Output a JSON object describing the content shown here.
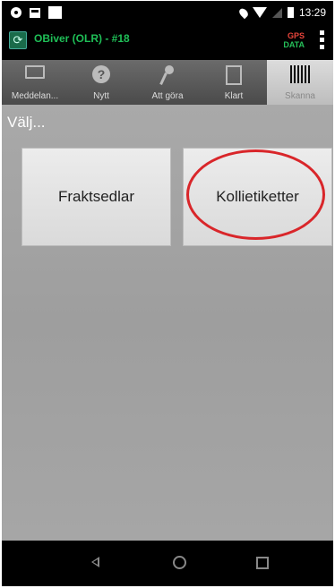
{
  "status_bar": {
    "time": "13:29",
    "icons": [
      "settings-icon",
      "notification-icon",
      "notification-icon",
      "location-icon",
      "wifi-icon",
      "signal-icon",
      "battery-icon"
    ]
  },
  "app_header": {
    "title": "OBiver (OLR) - #18",
    "gps_label": "GPS",
    "data_label": "DATA",
    "colors": {
      "title": "#1fbf57",
      "gps": "#e9453b",
      "data": "#26c05a"
    }
  },
  "tabs": [
    {
      "label": "Meddelan...",
      "icon": "envelope-icon"
    },
    {
      "label": "Nytt",
      "icon": "question-icon"
    },
    {
      "label": "Att göra",
      "icon": "pin-icon"
    },
    {
      "label": "Klart",
      "icon": "clipboard-check-icon"
    },
    {
      "label": "Skanna",
      "icon": "barcode-icon",
      "active": true
    }
  ],
  "content": {
    "prompt": "Välj...",
    "buttons": [
      {
        "label": "Fraktsedlar"
      },
      {
        "label": "Kollietiketter",
        "highlighted": true
      }
    ],
    "highlight_color": "#d9262a"
  },
  "nav_bar": {
    "icons": [
      "back-icon",
      "home-icon",
      "recents-icon"
    ]
  }
}
